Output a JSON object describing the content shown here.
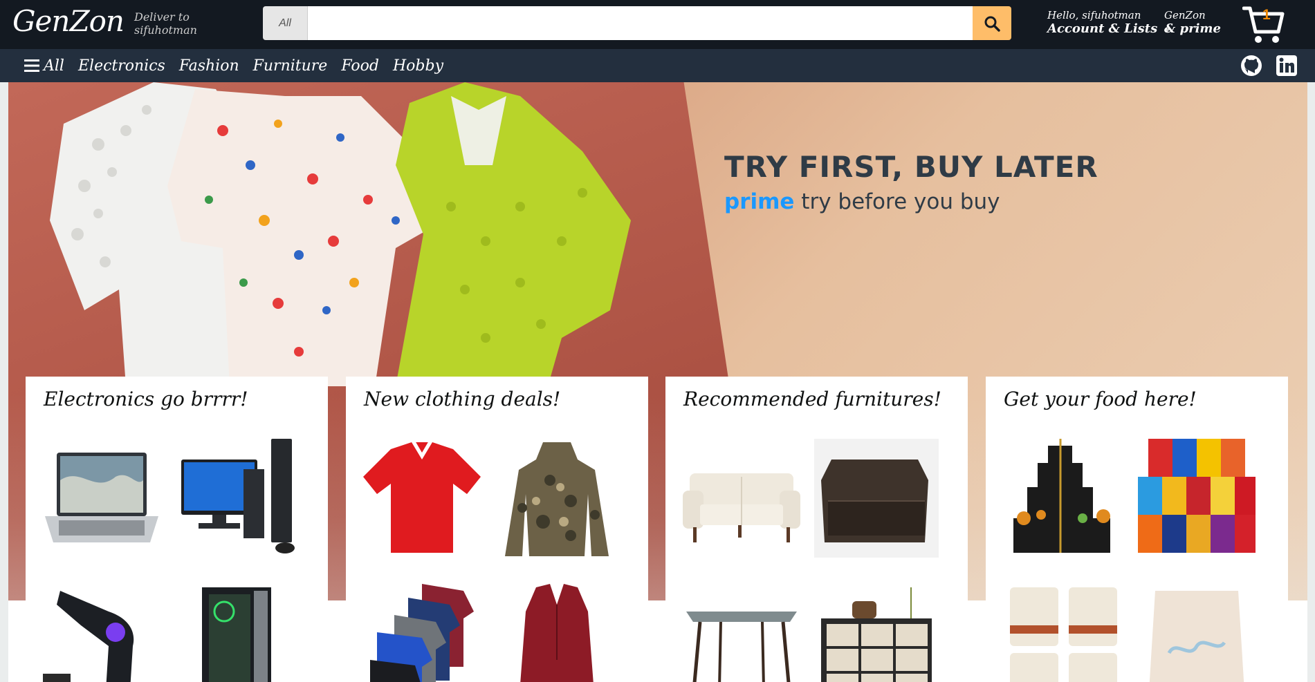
{
  "header": {
    "logo": "GenZon",
    "deliver_line1": "Deliver to",
    "deliver_line2": "sifuhotman",
    "search": {
      "category": "All",
      "placeholder": "",
      "value": ""
    },
    "account_line1": "Hello, sifuhotman",
    "account_line2": "Account & Lists",
    "prime_line1": "GenZon",
    "prime_line2": "& prime",
    "cart_count": "1"
  },
  "nav": {
    "all": "All",
    "items": [
      "Electronics",
      "Fashion",
      "Furniture",
      "Food",
      "Hobby"
    ]
  },
  "hero": {
    "title": "TRY FIRST, BUY LATER",
    "prime_word": "prime",
    "subtitle": "try before you buy"
  },
  "cards": [
    {
      "title": "Electronics go brrrr!",
      "items": [
        "laptop",
        "desktop-computer",
        "air-blower",
        "gaming-pc"
      ]
    },
    {
      "title": "New clothing deals!",
      "items": [
        "red-polo-shirt",
        "camo-hoodie",
        "t-shirt-stack",
        "red-blouse"
      ]
    },
    {
      "title": "Recommended furnitures!",
      "items": [
        "white-sofa",
        "brown-chair-bed",
        "glass-table",
        "drawer-dresser"
      ]
    },
    {
      "title": "Get your food here!",
      "items": [
        "gift-tower",
        "snack-box",
        "food-cans",
        "snack-bag"
      ]
    }
  ],
  "colors": {
    "header_bg": "#131921",
    "nav_bg": "#232f3e",
    "search_button": "#febd69",
    "prime_blue": "#1a98ff",
    "cart_badge": "#f08804"
  }
}
